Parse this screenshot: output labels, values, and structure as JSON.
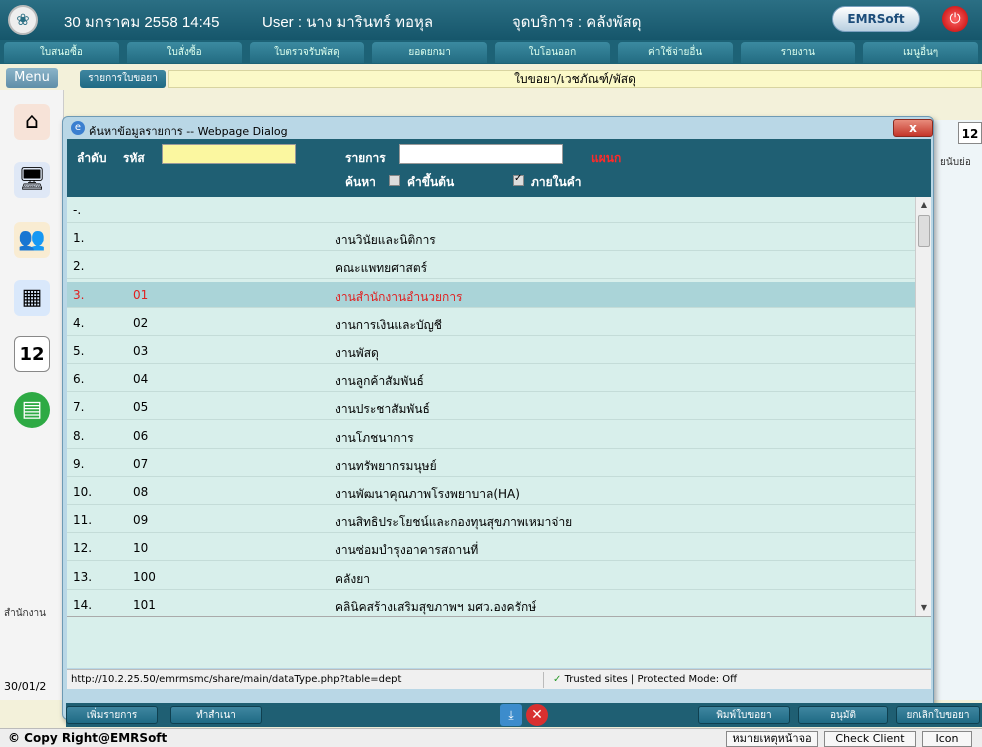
{
  "header": {
    "datetime": "30 มกราคม 2558 14:45",
    "user": "User : นาง มารินทร์ ทอหุล",
    "service_point": "จุดบริการ : คลังพัสดุ",
    "logo_text": "EMRSoft"
  },
  "nav": {
    "tabs": [
      "ใบสนอซื้อ",
      "ใบสั่งซื้อ",
      "ใบตรวจรับพัสดุ",
      "ยอดยกมา",
      "ใบโอนออก",
      "ค่าใช้จ่ายอื่น",
      "รายงาน",
      "เมนูอื่นๆ"
    ]
  },
  "sidebar": {
    "menu_label": "Menu",
    "bottom_text": "สำนักงาน",
    "date": "30/01/2",
    "calendar_day": "12"
  },
  "subbar": {
    "tab_label": "รายการใบขอยา",
    "page_title": "ใบขอยา/เวชภัณฑ์/พัสดุ"
  },
  "behind": {
    "calendar_day": "12",
    "text": "ยนับย่อ"
  },
  "dialog": {
    "title": "ค้นหาข้อมูลรายการ -- Webpage Dialog",
    "close_label": "x",
    "order_label": "ลำดับ",
    "code_label": "รหัส",
    "code_value": "",
    "item_label": "รายการ",
    "item_value": "",
    "dept_label": "แผนก",
    "search_label": "ค้นหา",
    "starts_with_label": "คำขึ้นต้น",
    "contains_label": "ภายในคำ",
    "starts_with_checked": false,
    "contains_checked": true,
    "rows": [
      {
        "no": "-.",
        "code": "",
        "name": ""
      },
      {
        "no": "1.",
        "code": "",
        "name": "งานวินัยและนิติการ"
      },
      {
        "no": "2.",
        "code": "",
        "name": "คณะแพทยศาสตร์"
      },
      {
        "no": "3.",
        "code": "01",
        "name": "งานสำนักงานอำนวยการ"
      },
      {
        "no": "4.",
        "code": "02",
        "name": "งานการเงินและบัญชี"
      },
      {
        "no": "5.",
        "code": "03",
        "name": "งานพัสดุ"
      },
      {
        "no": "6.",
        "code": "04",
        "name": "งานลูกค้าสัมพันธ์"
      },
      {
        "no": "7.",
        "code": "05",
        "name": "งานประชาสัมพันธ์"
      },
      {
        "no": "8.",
        "code": "06",
        "name": "งานโภชนาการ"
      },
      {
        "no": "9.",
        "code": "07",
        "name": "งานทรัพยากรมนุษย์"
      },
      {
        "no": "10.",
        "code": "08",
        "name": "งานพัฒนาคุณภาพโรงพยาบาล(HA)"
      },
      {
        "no": "11.",
        "code": "09",
        "name": "งานสิทธิประโยชน์และกองทุนสุขภาพเหมาจ่าย"
      },
      {
        "no": "12.",
        "code": "10",
        "name": "งานซ่อมบำรุงอาคารสถานที่"
      },
      {
        "no": "13.",
        "code": "100",
        "name": "คลังยา"
      },
      {
        "no": "14.",
        "code": "101",
        "name": "คลินิคสร้างเสริมสุขภาพฯ มศว.องครักษ์"
      }
    ],
    "selected_index": 3,
    "status_url": "http://10.2.25.50/emrmsmc/share/main/dataType.php?table=dept",
    "status_trust": "Trusted sites | Protected Mode: Off"
  },
  "actions": {
    "add_item": "เพิ่มรายการ",
    "duplicate": "ทำสำเนา",
    "print": "พิมพ์ใบขอยา",
    "approve": "อนุมัติ",
    "cancel_request": "ยกเลิกใบขอยา"
  },
  "footer": {
    "copyright": "© Copy Right@EMRSoft",
    "note_btn": "หมายเหตุหน้าจอ",
    "check_client": "Check Client",
    "icon_btn": "Icon"
  },
  "colors": {
    "header_bg": "#1f5f73",
    "selected_row_text": "#e02020",
    "list_bg": "#d8efeb"
  }
}
